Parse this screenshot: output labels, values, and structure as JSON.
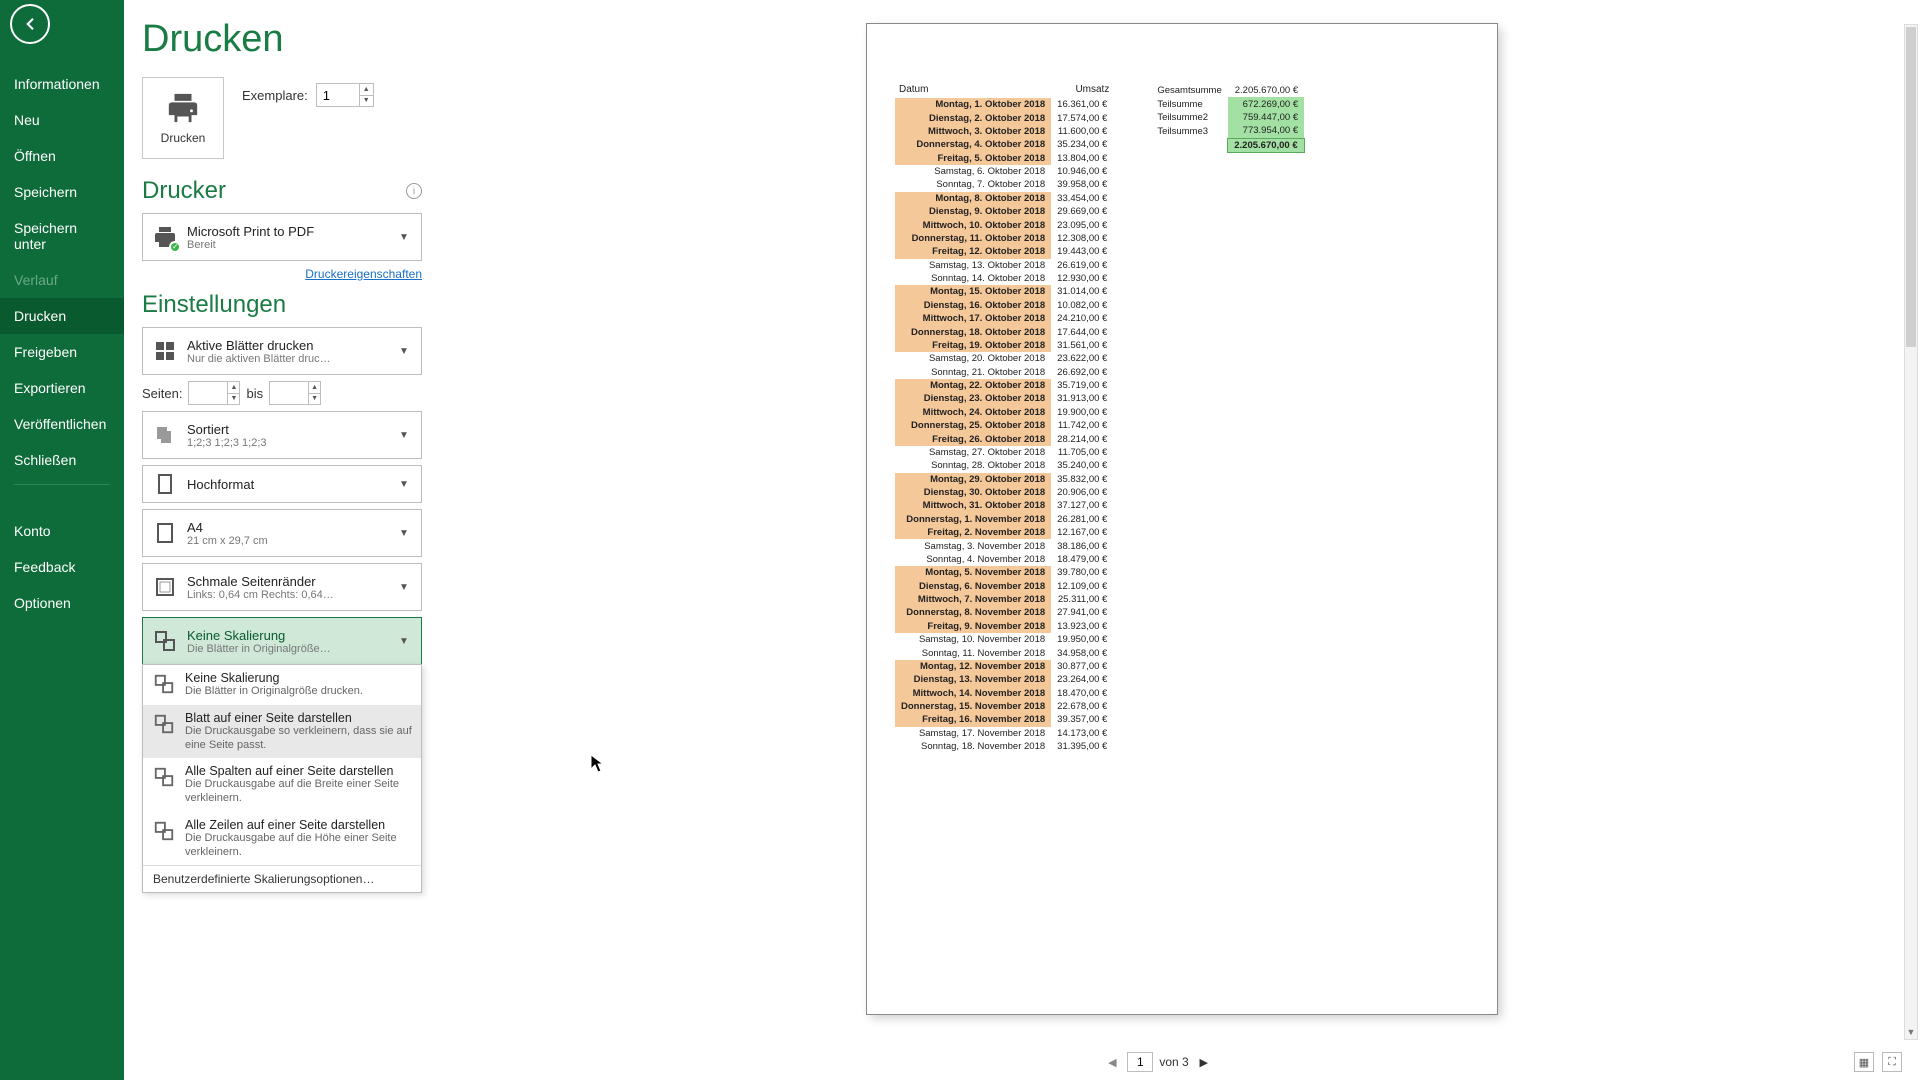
{
  "sidebar": {
    "items": [
      {
        "label": "Informationen"
      },
      {
        "label": "Neu"
      },
      {
        "label": "Öffnen"
      },
      {
        "label": "Speichern"
      },
      {
        "label": "Speichern unter"
      },
      {
        "label": "Verlauf",
        "disabled": true
      },
      {
        "label": "Drucken",
        "active": true
      },
      {
        "label": "Freigeben"
      },
      {
        "label": "Exportieren"
      },
      {
        "label": "Veröffentlichen"
      },
      {
        "label": "Schließen"
      }
    ],
    "bottom": [
      {
        "label": "Konto"
      },
      {
        "label": "Feedback"
      },
      {
        "label": "Optionen"
      }
    ]
  },
  "print": {
    "title": "Drucken",
    "button_label": "Drucken",
    "copies_label": "Exemplare:",
    "copies_value": "1"
  },
  "printer": {
    "heading": "Drucker",
    "name": "Microsoft Print to PDF",
    "status": "Bereit",
    "props_link": "Druckereigenschaften"
  },
  "settings": {
    "heading": "Einstellungen",
    "what": {
      "line1": "Aktive Blätter drucken",
      "line2": "Nur die aktiven Blätter druc…"
    },
    "pages": {
      "label": "Seiten:",
      "to_label": "bis",
      "from": "",
      "to": ""
    },
    "collate": {
      "line1": "Sortiert",
      "line2": "1;2;3    1;2;3    1;2;3"
    },
    "orientation": {
      "line1": "Hochformat"
    },
    "paper": {
      "line1": "A4",
      "line2": "21 cm x 29,7 cm"
    },
    "margins": {
      "line1": "Schmale Seitenränder",
      "line2": "Links: 0,64 cm   Rechts: 0,64…"
    },
    "scaling": {
      "line1": "Keine Skalierung",
      "line2": "Die Blätter in Originalgröße…"
    },
    "scaling_options": [
      {
        "t1": "Keine Skalierung",
        "t2": "Die Blätter in Originalgröße drucken."
      },
      {
        "t1": "Blatt auf einer Seite darstellen",
        "t2": "Die Druckausgabe so verkleinern, dass sie auf eine Seite passt.",
        "hover": true
      },
      {
        "t1": "Alle Spalten auf einer Seite darstellen",
        "t2": "Die Druckausgabe auf die Breite einer Seite verkleinern."
      },
      {
        "t1": "Alle Zeilen auf einer Seite darstellen",
        "t2": "Die Druckausgabe auf die Höhe einer Seite verkleinern."
      }
    ],
    "scaling_custom": "Benutzerdefinierte Skalierungsoptionen…"
  },
  "preview": {
    "headers": {
      "date": "Datum",
      "amount": "Umsatz"
    },
    "rows": [
      {
        "d": "Montag, 1. Oktober 2018",
        "a": "16.361,00 €",
        "hl": true
      },
      {
        "d": "Dienstag, 2. Oktober 2018",
        "a": "17.574,00 €",
        "hl": true
      },
      {
        "d": "Mittwoch, 3. Oktober 2018",
        "a": "11.600,00 €",
        "hl": true
      },
      {
        "d": "Donnerstag, 4. Oktober 2018",
        "a": "35.234,00 €",
        "hl": true
      },
      {
        "d": "Freitag, 5. Oktober 2018",
        "a": "13.804,00 €",
        "hl": true
      },
      {
        "d": "Samstag, 6. Oktober 2018",
        "a": "10.946,00 €"
      },
      {
        "d": "Sonntag, 7. Oktober 2018",
        "a": "39.958,00 €"
      },
      {
        "d": "Montag, 8. Oktober 2018",
        "a": "33.454,00 €",
        "hl": true
      },
      {
        "d": "Dienstag, 9. Oktober 2018",
        "a": "29.669,00 €",
        "hl": true
      },
      {
        "d": "Mittwoch, 10. Oktober 2018",
        "a": "23.095,00 €",
        "hl": true
      },
      {
        "d": "Donnerstag, 11. Oktober 2018",
        "a": "12.308,00 €",
        "hl": true
      },
      {
        "d": "Freitag, 12. Oktober 2018",
        "a": "19.443,00 €",
        "hl": true
      },
      {
        "d": "Samstag, 13. Oktober 2018",
        "a": "26.619,00 €"
      },
      {
        "d": "Sonntag, 14. Oktober 2018",
        "a": "12.930,00 €"
      },
      {
        "d": "Montag, 15. Oktober 2018",
        "a": "31.014,00 €",
        "hl": true
      },
      {
        "d": "Dienstag, 16. Oktober 2018",
        "a": "10.082,00 €",
        "hl": true
      },
      {
        "d": "Mittwoch, 17. Oktober 2018",
        "a": "24.210,00 €",
        "hl": true
      },
      {
        "d": "Donnerstag, 18. Oktober 2018",
        "a": "17.644,00 €",
        "hl": true
      },
      {
        "d": "Freitag, 19. Oktober 2018",
        "a": "31.561,00 €",
        "hl": true
      },
      {
        "d": "Samstag, 20. Oktober 2018",
        "a": "23.622,00 €"
      },
      {
        "d": "Sonntag, 21. Oktober 2018",
        "a": "26.692,00 €"
      },
      {
        "d": "Montag, 22. Oktober 2018",
        "a": "35.719,00 €",
        "hl": true
      },
      {
        "d": "Dienstag, 23. Oktober 2018",
        "a": "31.913,00 €",
        "hl": true
      },
      {
        "d": "Mittwoch, 24. Oktober 2018",
        "a": "19.900,00 €",
        "hl": true
      },
      {
        "d": "Donnerstag, 25. Oktober 2018",
        "a": "11.742,00 €",
        "hl": true
      },
      {
        "d": "Freitag, 26. Oktober 2018",
        "a": "28.214,00 €",
        "hl": true
      },
      {
        "d": "Samstag, 27. Oktober 2018",
        "a": "11.705,00 €"
      },
      {
        "d": "Sonntag, 28. Oktober 2018",
        "a": "35.240,00 €"
      },
      {
        "d": "Montag, 29. Oktober 2018",
        "a": "35.832,00 €",
        "hl": true
      },
      {
        "d": "Dienstag, 30. Oktober 2018",
        "a": "20.906,00 €",
        "hl": true
      },
      {
        "d": "Mittwoch, 31. Oktober 2018",
        "a": "37.127,00 €",
        "hl": true
      },
      {
        "d": "Donnerstag, 1. November 2018",
        "a": "26.281,00 €",
        "hl": true
      },
      {
        "d": "Freitag, 2. November 2018",
        "a": "12.167,00 €",
        "hl": true
      },
      {
        "d": "Samstag, 3. November 2018",
        "a": "38.186,00 €"
      },
      {
        "d": "Sonntag, 4. November 2018",
        "a": "18.479,00 €"
      },
      {
        "d": "Montag, 5. November 2018",
        "a": "39.780,00 €",
        "hl": true
      },
      {
        "d": "Dienstag, 6. November 2018",
        "a": "12.109,00 €",
        "hl": true
      },
      {
        "d": "Mittwoch, 7. November 2018",
        "a": "25.311,00 €",
        "hl": true
      },
      {
        "d": "Donnerstag, 8. November 2018",
        "a": "27.941,00 €",
        "hl": true
      },
      {
        "d": "Freitag, 9. November 2018",
        "a": "13.923,00 €",
        "hl": true
      },
      {
        "d": "Samstag, 10. November 2018",
        "a": "19.950,00 €"
      },
      {
        "d": "Sonntag, 11. November 2018",
        "a": "34.958,00 €"
      },
      {
        "d": "Montag, 12. November 2018",
        "a": "30.877,00 €",
        "hl": true
      },
      {
        "d": "Dienstag, 13. November 2018",
        "a": "23.264,00 €",
        "hl": true
      },
      {
        "d": "Mittwoch, 14. November 2018",
        "a": "18.470,00 €",
        "hl": true
      },
      {
        "d": "Donnerstag, 15. November 2018",
        "a": "22.678,00 €",
        "hl": true
      },
      {
        "d": "Freitag, 16. November 2018",
        "a": "39.357,00 €",
        "hl": true
      },
      {
        "d": "Samstag, 17. November 2018",
        "a": "14.173,00 €"
      },
      {
        "d": "Sonntag, 18. November 2018",
        "a": "31.395,00 €"
      }
    ],
    "summary": [
      {
        "lbl": "Gesamtsumme",
        "val": "2.205.670,00 €",
        "cls": ""
      },
      {
        "lbl": "Teilsumme",
        "val": "672.269,00 €",
        "cls": "bar"
      },
      {
        "lbl": "Teilsumme2",
        "val": "759.447,00 €",
        "cls": "bar"
      },
      {
        "lbl": "Teilsumme3",
        "val": "773.954,00 €",
        "cls": "bar"
      },
      {
        "lbl": "",
        "val": "2.205.670,00 €",
        "cls": "total"
      }
    ]
  },
  "pager": {
    "page": "1",
    "of": "von 3"
  }
}
